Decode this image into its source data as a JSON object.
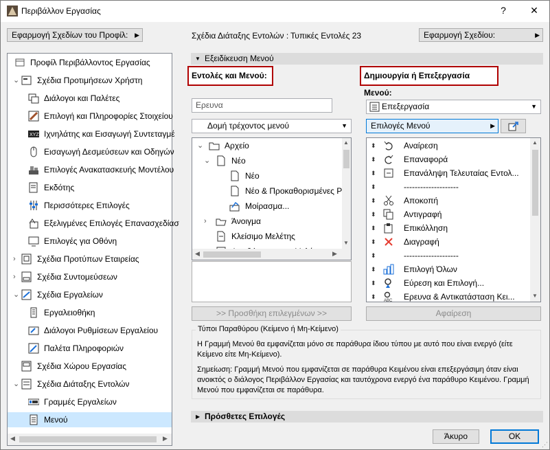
{
  "window": {
    "title": "Περιβάλλον Εργασίας",
    "help": "?",
    "close": "✕"
  },
  "top": {
    "profile_button": "Εφαρμογή Σχεδίων του Προφίλ:",
    "schema_label": "Σχέδια Διάταξης Εντολών :",
    "schema_value": "Τυπικές Εντολές 23",
    "apply_button": "Εφαρμογή Σχεδίου:"
  },
  "tree": {
    "items": [
      {
        "label": "Προφίλ Περιβάλλοντος Εργασίας",
        "icon": "profile-icon"
      },
      {
        "label": "Σχέδια Προτιμήσεων Χρήστη",
        "icon": "user-prefs-icon"
      },
      {
        "label": "Διάλογοι και Παλέτες",
        "icon": "dialogs-icon"
      },
      {
        "label": "Επιλογή και Πληροφορίες Στοιχείου",
        "icon": "selection-icon"
      },
      {
        "label": "Ιχνηλάτης και Εισαγωγή Συντεταγμέ",
        "icon": "xyz-icon"
      },
      {
        "label": "Εισαγωγή Δεσμεύσεων και Οδηγών",
        "icon": "mouse-icon"
      },
      {
        "label": "Επιλογές Ανακατασκευής Μοντέλου",
        "icon": "model-icon"
      },
      {
        "label": "Εκδότης",
        "icon": "editor-icon"
      },
      {
        "label": "Περισσότερες Επιλογές",
        "icon": "sliders-icon"
      },
      {
        "label": "Εξελιγμένες Επιλογές Επανασχεδίασ",
        "icon": "redraw-icon"
      },
      {
        "label": "Επιλογές για Οθόνη",
        "icon": "monitor-icon"
      },
      {
        "label": "Σχέδια Προτύπων Εταιρείας",
        "icon": "company-icon"
      },
      {
        "label": "Σχέδια Συντομεύσεων",
        "icon": "shortcuts-icon"
      },
      {
        "label": "Σχέδια Εργαλείων",
        "icon": "tools-icon"
      },
      {
        "label": "Εργαλειοθήκη",
        "icon": "toolbox-icon"
      },
      {
        "label": "Διάλογοι Ρυθμίσεων Εργαλείου",
        "icon": "tool-settings-icon"
      },
      {
        "label": "Παλέτα Πληροφοριών",
        "icon": "info-palette-icon"
      },
      {
        "label": "Σχέδια Χώρου Εργασίας",
        "icon": "workspace-icon"
      },
      {
        "label": "Σχέδια Διάταξης Εντολών",
        "icon": "command-layout-icon"
      },
      {
        "label": "Γραμμές Εργαλείων",
        "icon": "toolbars-icon"
      },
      {
        "label": "Μενού",
        "icon": "menu-icon"
      }
    ]
  },
  "section": {
    "title": "Εξειδίκευση Μενού",
    "bottom_title": "Πρόσθετες Επιλογές"
  },
  "left": {
    "heading": "Εντολές και Μενού:",
    "search_placeholder": "Ερευνα",
    "structure_combo": "Δομή τρέχοντος μενού",
    "items": [
      {
        "label": "Αρχείο",
        "icon": "folder-icon"
      },
      {
        "label": "Νέο",
        "icon": "new-doc-icon"
      },
      {
        "label": "Νέο",
        "icon": "new-doc-icon"
      },
      {
        "label": "Νέο & Προκαθορισμένες Ρυθ",
        "icon": "new-doc-icon"
      },
      {
        "label": "Μοίρασμα...",
        "icon": "share-icon"
      },
      {
        "label": "Άνοιγμα",
        "icon": "open-folder-icon"
      },
      {
        "label": "Κλείσιμο Μελέτης",
        "icon": "close-doc-icon"
      },
      {
        "label": "Αποθήκευση της Μελέτης",
        "icon": "save-icon"
      }
    ],
    "add_button": ">> Προσθήκη επιλεγμένων >>"
  },
  "right": {
    "heading": "Δημιουργία ή Επεξεργασία Μενού:",
    "menu_combo": "Επεξεργασία",
    "options_button": "Επιλογές Μενού",
    "items": [
      {
        "label": "Αναίρεση",
        "icon": "undo-icon"
      },
      {
        "label": "Επαναφορά",
        "icon": "redo-icon"
      },
      {
        "label": "Επανάληψη Τελευταίας Εντολ...",
        "icon": "repeat-icon"
      },
      {
        "label": "--------------------",
        "icon": ""
      },
      {
        "label": "Αποκοπή",
        "icon": "scissors-icon"
      },
      {
        "label": "Αντιγραφή",
        "icon": "copy-icon"
      },
      {
        "label": "Επικόλληση",
        "icon": "paste-icon"
      },
      {
        "label": "Διαγραφή",
        "icon": "delete-icon"
      },
      {
        "label": "--------------------",
        "icon": ""
      },
      {
        "label": "Επιλογή Όλων",
        "icon": "select-all-icon"
      },
      {
        "label": "Εύρεση και Επιλογή...",
        "icon": "find-select-icon"
      },
      {
        "label": "Ερευνα & Αντικατάσταση Κει...",
        "icon": "find-replace-icon"
      }
    ],
    "remove_button": "Αφαίρεση"
  },
  "info": {
    "legend": "Τύποι Παραθύρου (Κείμενο ή Μη-Κείμενο)",
    "text1": "Η Γραμμή Μενού θα εμφανίζεται μόνο σε παράθυρα ίδιου τύπου με αυτό που είναι ενεργό (είτε Κείμενο είτε Μη-Κείμενο).",
    "text2": "Σημείωση: Γραμμή Μενού που εμφανίζεται σε παράθυρα Κειμένου είναι επεξεργάσιμη όταν είναι ανοικτός ο διάλογος Περιβάλλον Εργασίας και ταυτόχρονα ενεργό ένα παράθυρο Κειμένου. Γραμμή Μενού που εμφανίζεται σε παράθυρα."
  },
  "footer": {
    "cancel": "Άκυρο",
    "ok": "OK"
  }
}
